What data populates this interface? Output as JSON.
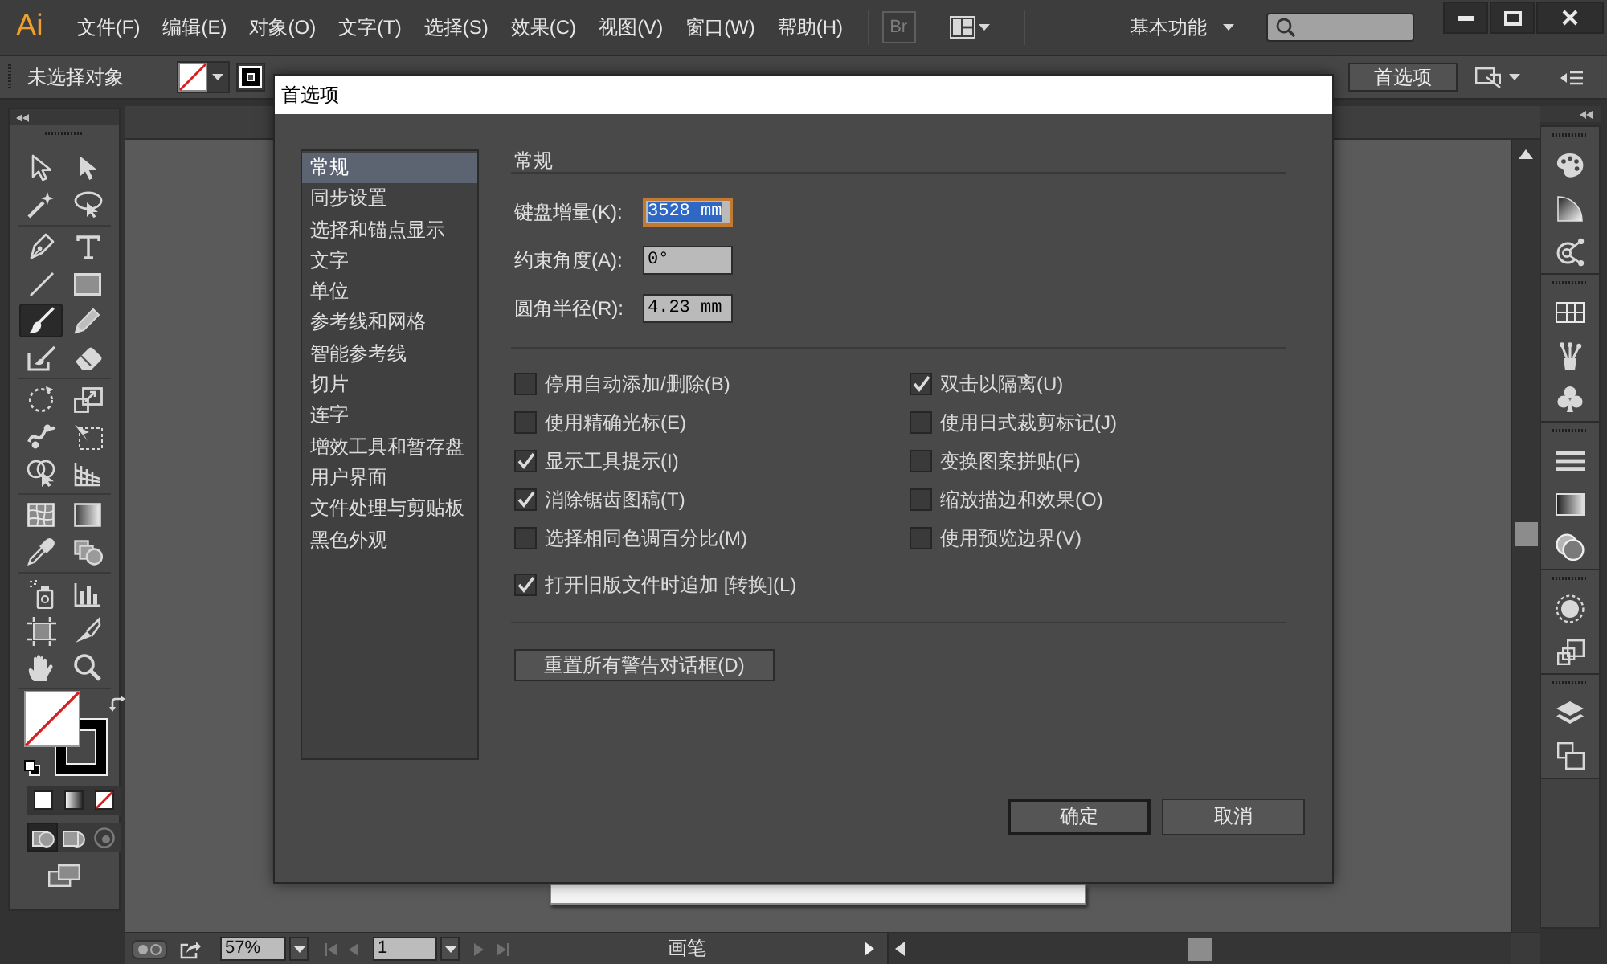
{
  "menu_bar": {
    "logo": "Ai",
    "menus": [
      "文件(F)",
      "编辑(E)",
      "对象(O)",
      "文字(T)",
      "选择(S)",
      "效果(C)",
      "视图(V)",
      "窗口(W)",
      "帮助(H)"
    ],
    "bridge_button": "Br",
    "workspace": "基本功能"
  },
  "control_bar": {
    "selection_status": "未选择对象",
    "preferences_button": "首选项"
  },
  "tool_groups": [
    [
      {
        "selected": false
      },
      {
        "selected": false
      },
      {
        "selected": false
      },
      {
        "selected": false
      }
    ],
    [
      {
        "selected": false
      },
      {
        "selected": false
      },
      {
        "selected": false
      },
      {
        "selected": false
      },
      {
        "selected": true
      },
      {
        "selected": false
      },
      {
        "selected": false
      },
      {
        "selected": false
      }
    ],
    [
      {
        "selected": false
      },
      {
        "selected": false
      },
      {
        "selected": false
      },
      {
        "selected": false
      },
      {
        "selected": false
      },
      {
        "selected": false
      }
    ],
    [
      {
        "selected": false
      },
      {
        "selected": false
      },
      {
        "selected": false
      },
      {
        "selected": false
      }
    ],
    [
      {
        "selected": false
      },
      {
        "selected": false
      },
      {
        "selected": false
      },
      {
        "selected": false
      },
      {
        "selected": false
      },
      {
        "selected": false
      }
    ]
  ],
  "draw_modes": [
    {
      "selected": true
    },
    {
      "selected": false
    },
    {
      "selected": false
    }
  ],
  "status_bar": {
    "zoom": "57%",
    "artboard_number": "1",
    "current_tool": "画笔"
  },
  "preferences_dialog": {
    "title": "首选项",
    "categories": [
      {
        "label": "常规",
        "selected": true
      },
      {
        "label": "同步设置",
        "selected": false
      },
      {
        "label": "选择和锚点显示",
        "selected": false
      },
      {
        "label": "文字",
        "selected": false
      },
      {
        "label": "单位",
        "selected": false
      },
      {
        "label": "参考线和网格",
        "selected": false
      },
      {
        "label": "智能参考线",
        "selected": false
      },
      {
        "label": "切片",
        "selected": false
      },
      {
        "label": "连字",
        "selected": false
      },
      {
        "label": "增效工具和暂存盘",
        "selected": false
      },
      {
        "label": "用户界面",
        "selected": false
      },
      {
        "label": "文件处理与剪贴板",
        "selected": false
      },
      {
        "label": "黑色外观",
        "selected": false
      }
    ],
    "section_title": "常规",
    "fields": [
      {
        "label": "键盘增量(K):",
        "value": "3528 mm",
        "focused": true
      },
      {
        "label": "约束角度(A):",
        "value": "0°",
        "focused": false
      },
      {
        "label": "圆角半径(R):",
        "value": "4.23 mm",
        "focused": false
      }
    ],
    "option_columns": [
      [
        {
          "label": "停用自动添加/删除(B)",
          "checked": false
        },
        {
          "label": "使用精确光标(E)",
          "checked": false
        },
        {
          "label": "显示工具提示(I)",
          "checked": true
        },
        {
          "label": "消除锯齿图稿(T)",
          "checked": true
        },
        {
          "label": "选择相同色调百分比(M)",
          "checked": false
        }
      ],
      [
        {
          "label": "双击以隔离(U)",
          "checked": true
        },
        {
          "label": "使用日式裁剪标记(J)",
          "checked": false
        },
        {
          "label": "变换图案拼贴(F)",
          "checked": false
        },
        {
          "label": "缩放描边和效果(O)",
          "checked": false
        },
        {
          "label": "使用预览边界(V)",
          "checked": false
        }
      ]
    ],
    "legacy_option": {
      "label": "打开旧版文件时追加 [转换](L)",
      "checked": true
    },
    "reset_button": "重置所有警告对话框(D)",
    "footer_buttons": [
      {
        "label": "确定",
        "default": true
      },
      {
        "label": "取消",
        "default": false
      }
    ]
  }
}
